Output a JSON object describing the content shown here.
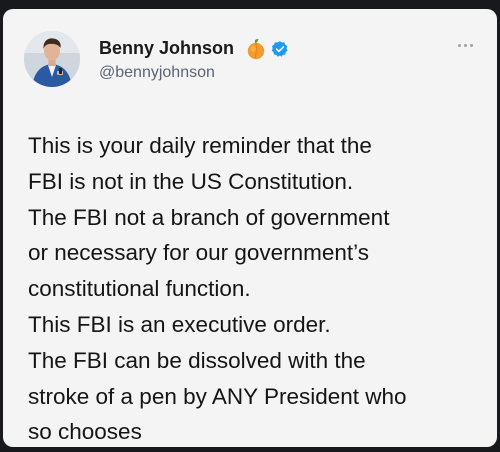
{
  "author": {
    "display_name": "Benny Johnson",
    "handle": "@bennyjohnson",
    "emoji_icon": "peach-icon",
    "verified_icon": "verified-badge-icon",
    "verified_color": "#1d9bf0"
  },
  "tweet": {
    "lines": [
      "This is your daily reminder that the",
      "FBI is not in the US Constitution.",
      "The FBI not a branch of government",
      "or necessary for our government’s",
      "constitutional function.",
      "This FBI is an executive order.",
      "The FBI can be dissolved with the",
      "stroke of a pen by ANY President who",
      "so chooses"
    ]
  },
  "menu": {
    "icon": "more-options-icon"
  }
}
